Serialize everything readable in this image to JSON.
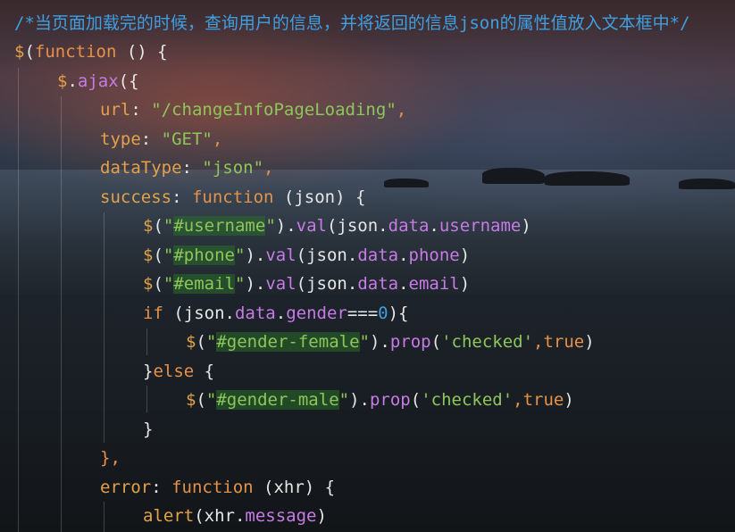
{
  "lines": [
    [
      {
        "t": "/*当页面加载完的时候，查询用户的信息，并将返回的信息json的属性值放入文本框中*/",
        "c": "comment"
      }
    ],
    [
      {
        "t": "$",
        "c": "fn"
      },
      {
        "t": "(",
        "c": "plain"
      },
      {
        "t": "function",
        "c": "kw"
      },
      {
        "t": " () {",
        "c": "plain"
      }
    ],
    [
      {
        "t": "$",
        "c": "fn"
      },
      {
        "t": ".",
        "c": "plain"
      },
      {
        "t": "ajax",
        "c": "prop"
      },
      {
        "t": "({",
        "c": "plain"
      }
    ],
    [
      {
        "t": "url",
        "c": "fn"
      },
      {
        "t": ": ",
        "c": "plain"
      },
      {
        "t": "\"/changeInfoPageLoading\"",
        "c": "str"
      },
      {
        "t": ",",
        "c": "kw"
      }
    ],
    [
      {
        "t": "type",
        "c": "fn"
      },
      {
        "t": ": ",
        "c": "plain"
      },
      {
        "t": "\"GET\"",
        "c": "str"
      },
      {
        "t": ",",
        "c": "kw"
      }
    ],
    [
      {
        "t": "dataType",
        "c": "fn"
      },
      {
        "t": ": ",
        "c": "plain"
      },
      {
        "t": "\"json\"",
        "c": "str"
      },
      {
        "t": ",",
        "c": "kw"
      }
    ],
    [
      {
        "t": "success",
        "c": "fn"
      },
      {
        "t": ": ",
        "c": "plain"
      },
      {
        "t": "function",
        "c": "kw"
      },
      {
        "t": " (json) {",
        "c": "plain"
      }
    ],
    [
      {
        "t": "$",
        "c": "fn"
      },
      {
        "t": "(",
        "c": "plain"
      },
      {
        "t": "\"",
        "c": "str"
      },
      {
        "t": "#username",
        "c": "str",
        "hl": true
      },
      {
        "t": "\"",
        "c": "str"
      },
      {
        "t": ").",
        "c": "plain"
      },
      {
        "t": "val",
        "c": "prop"
      },
      {
        "t": "(json.",
        "c": "plain"
      },
      {
        "t": "data",
        "c": "prop"
      },
      {
        "t": ".",
        "c": "plain"
      },
      {
        "t": "username",
        "c": "prop"
      },
      {
        "t": ")",
        "c": "plain"
      }
    ],
    [
      {
        "t": "$",
        "c": "fn"
      },
      {
        "t": "(",
        "c": "plain"
      },
      {
        "t": "\"",
        "c": "str"
      },
      {
        "t": "#phone",
        "c": "str",
        "hl": true
      },
      {
        "t": "\"",
        "c": "str"
      },
      {
        "t": ").",
        "c": "plain"
      },
      {
        "t": "val",
        "c": "prop"
      },
      {
        "t": "(json.",
        "c": "plain"
      },
      {
        "t": "data",
        "c": "prop"
      },
      {
        "t": ".",
        "c": "plain"
      },
      {
        "t": "phone",
        "c": "prop"
      },
      {
        "t": ")",
        "c": "plain"
      }
    ],
    [
      {
        "t": "$",
        "c": "fn"
      },
      {
        "t": "(",
        "c": "plain"
      },
      {
        "t": "\"",
        "c": "str"
      },
      {
        "t": "#email",
        "c": "str",
        "hl": true
      },
      {
        "t": "\"",
        "c": "str"
      },
      {
        "t": ").",
        "c": "plain"
      },
      {
        "t": "val",
        "c": "prop"
      },
      {
        "t": "(json.",
        "c": "plain"
      },
      {
        "t": "data",
        "c": "prop"
      },
      {
        "t": ".",
        "c": "plain"
      },
      {
        "t": "email",
        "c": "prop"
      },
      {
        "t": ")",
        "c": "plain"
      }
    ],
    [
      {
        "t": "if",
        "c": "kw"
      },
      {
        "t": " (json.",
        "c": "plain"
      },
      {
        "t": "data",
        "c": "prop"
      },
      {
        "t": ".",
        "c": "plain"
      },
      {
        "t": "gender",
        "c": "prop"
      },
      {
        "t": "===",
        "c": "plain"
      },
      {
        "t": "0",
        "c": "num"
      },
      {
        "t": "){",
        "c": "plain"
      }
    ],
    [
      {
        "t": "$",
        "c": "fn"
      },
      {
        "t": "(",
        "c": "plain"
      },
      {
        "t": "\"",
        "c": "str"
      },
      {
        "t": "#gender-female",
        "c": "str",
        "hl": true
      },
      {
        "t": "\"",
        "c": "str"
      },
      {
        "t": ").",
        "c": "plain"
      },
      {
        "t": "prop",
        "c": "prop"
      },
      {
        "t": "(",
        "c": "plain"
      },
      {
        "t": "'checked'",
        "c": "str"
      },
      {
        "t": ",",
        "c": "kw"
      },
      {
        "t": "true",
        "c": "kw"
      },
      {
        "t": ")",
        "c": "plain"
      }
    ],
    [
      {
        "t": "}",
        "c": "plain"
      },
      {
        "t": "else",
        "c": "kw"
      },
      {
        "t": " {",
        "c": "plain"
      }
    ],
    [
      {
        "t": "$",
        "c": "fn"
      },
      {
        "t": "(",
        "c": "plain"
      },
      {
        "t": "\"",
        "c": "str"
      },
      {
        "t": "#gender-male",
        "c": "str",
        "hl": true
      },
      {
        "t": "\"",
        "c": "str"
      },
      {
        "t": ").",
        "c": "plain"
      },
      {
        "t": "prop",
        "c": "prop"
      },
      {
        "t": "(",
        "c": "plain"
      },
      {
        "t": "'checked'",
        "c": "str"
      },
      {
        "t": ",",
        "c": "kw"
      },
      {
        "t": "true",
        "c": "kw"
      },
      {
        "t": ")",
        "c": "plain"
      }
    ],
    [
      {
        "t": "}",
        "c": "plain"
      }
    ],
    [
      {
        "t": "},",
        "c": "kw"
      }
    ],
    [
      {
        "t": "error",
        "c": "fn"
      },
      {
        "t": ": ",
        "c": "plain"
      },
      {
        "t": "function",
        "c": "kw"
      },
      {
        "t": " (xhr) {",
        "c": "plain"
      }
    ],
    [
      {
        "t": "alert",
        "c": "fn"
      },
      {
        "t": "(xhr.",
        "c": "plain"
      },
      {
        "t": "message",
        "c": "prop"
      },
      {
        "t": ")",
        "c": "plain"
      }
    ]
  ]
}
